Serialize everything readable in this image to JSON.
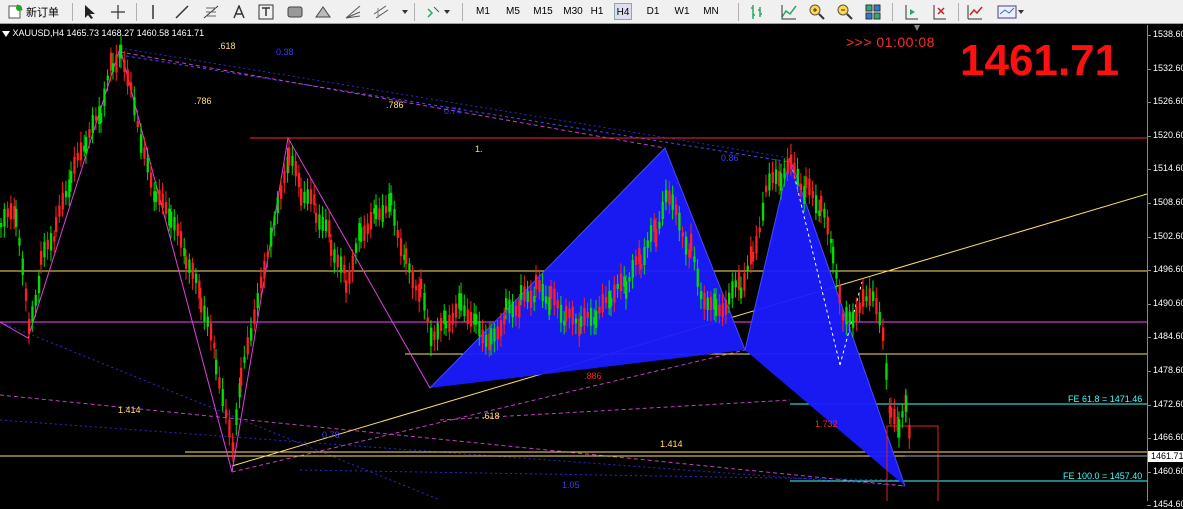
{
  "toolbar": {
    "new_order_label": "新订单",
    "timeframes": [
      "M1",
      "M5",
      "M15",
      "M30",
      "H1",
      "H4",
      "D1",
      "W1",
      "MN"
    ],
    "active_timeframe": "H4"
  },
  "chart": {
    "symbol_info": "XAUUSD,H4  1465.73 1468.27 1460.58 1461.71",
    "countdown": ">>> 01:00:08",
    "current_price": "1461.71",
    "current_price_tag": "1461.71",
    "price_scale": [
      "1538.60",
      "1532.60",
      "1526.60",
      "1520.60",
      "1514.60",
      "1508.60",
      "1502.60",
      "1496.60",
      "1490.60",
      "1484.60",
      "1478.60",
      "1472.60",
      "1466.60",
      "1460.60",
      "1454.60"
    ],
    "fib_labels": {
      "l618_top": ".618",
      "l786_a": ".786",
      "l786_b": ".786",
      "l1": "1.",
      "l1414_a": "1.414",
      "l1414_b": "1.414",
      "l618_mid": ".618",
      "l886": ".886",
      "l1732": "1.732",
      "blue_0_38": "0.38",
      "blue_0_74": "0.74",
      "blue_0_86": "0.86",
      "blue_0_78": "0.78",
      "blue_1_05": "1.05"
    },
    "fe_labels": {
      "fe618": "FE 61.8 = 1471.46",
      "fe100": "FE 100.0 = 1457.40"
    },
    "colors": {
      "bull": "#00e000",
      "bear": "#ff2020",
      "pattern_fill": "#1a1aff",
      "horizontal_red": "#ff2040",
      "horizontal_yellow": "#ffe066",
      "horizontal_magenta": "#ff40ff",
      "fe_line": "#40ffff"
    }
  }
}
